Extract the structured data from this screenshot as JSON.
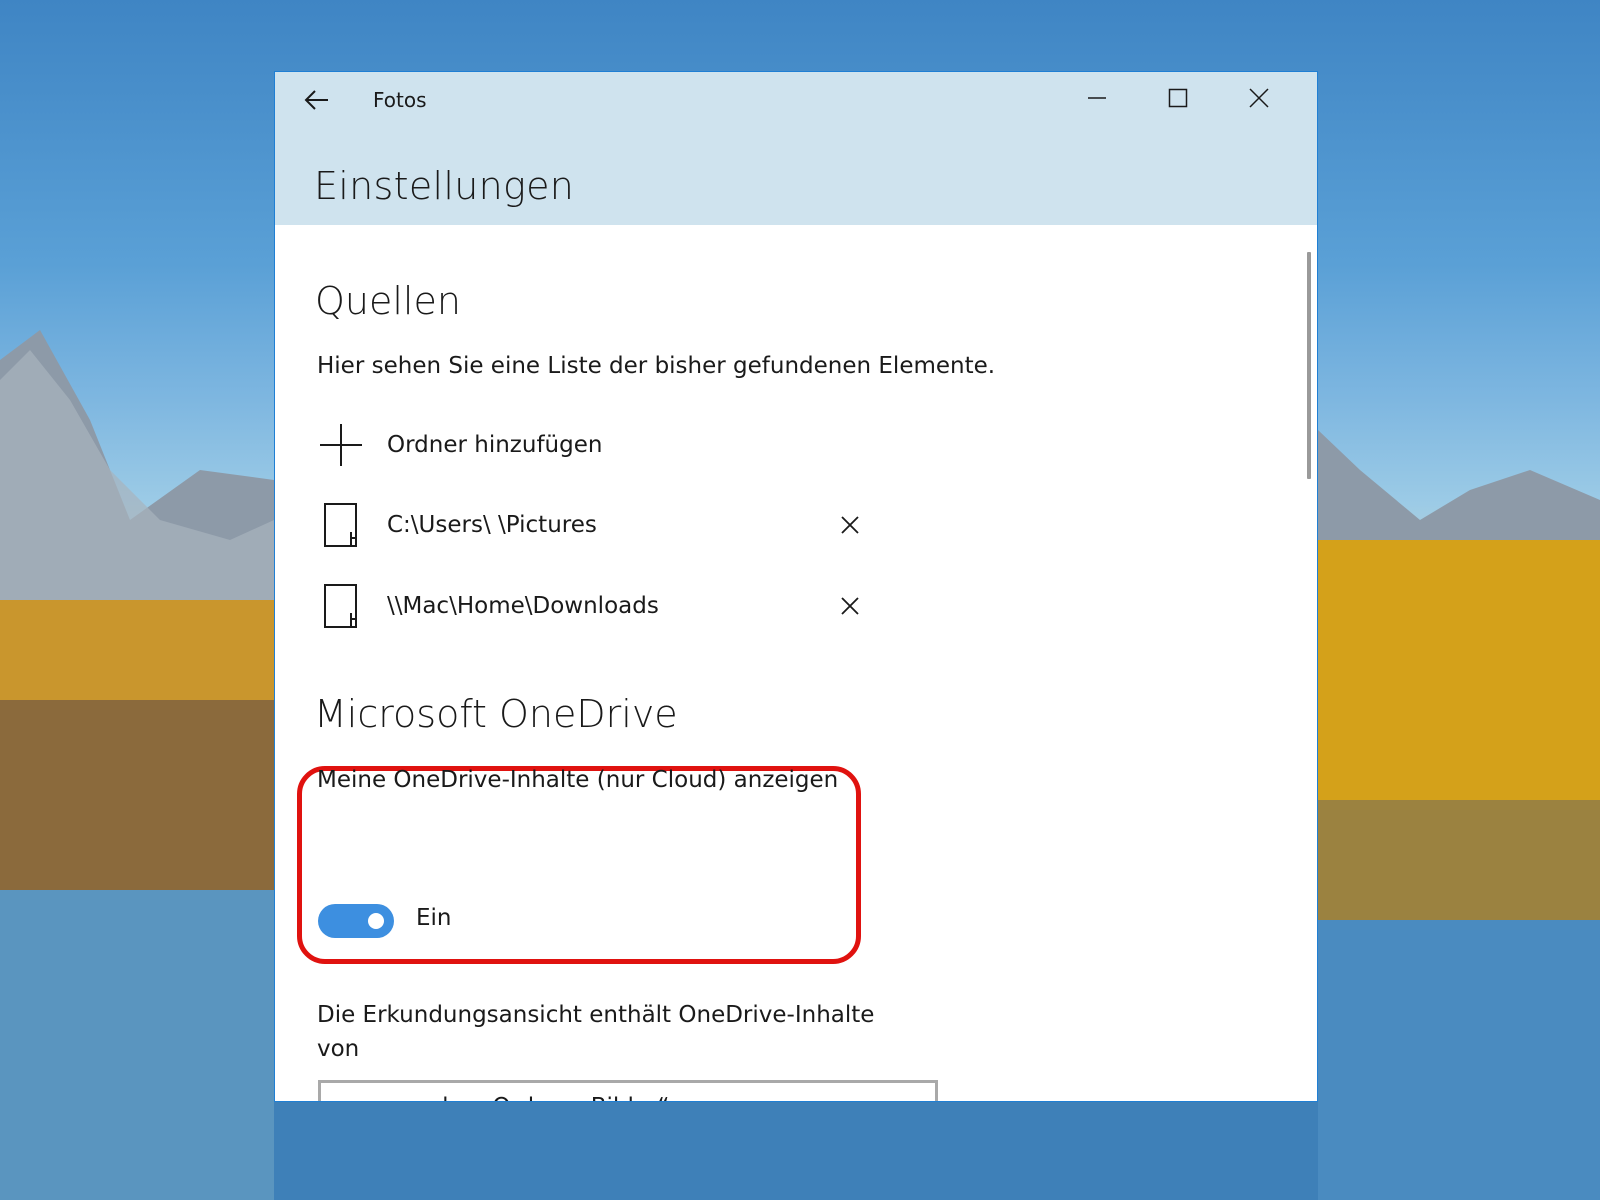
{
  "window": {
    "app_title": "Fotos",
    "page_title": "Einstellungen"
  },
  "sources": {
    "title": "Quellen",
    "description": "Hier sehen Sie eine Liste der bisher gefundenen Elemente.",
    "add_folder_label": "Ordner hinzufügen",
    "folders": [
      {
        "path": "C:\\Users\\      \\Pictures"
      },
      {
        "path": "\\\\Mac\\Home\\Downloads"
      }
    ]
  },
  "onedrive": {
    "title": "Microsoft OneDrive",
    "show_cloud_label": "Meine OneDrive-Inhalte (nur Cloud) anzeigen",
    "toggle_state": "Ein",
    "toggle_on": true,
    "explore_label": "Die Erkundungsansicht enthält OneDrive-Inhalte von",
    "explore_selected": "nur aus dem Ordner „Bilder“"
  },
  "colors": {
    "accent": "#3d8fe0",
    "titlebar": "#cfe3ee",
    "highlight": "#e0120f"
  }
}
